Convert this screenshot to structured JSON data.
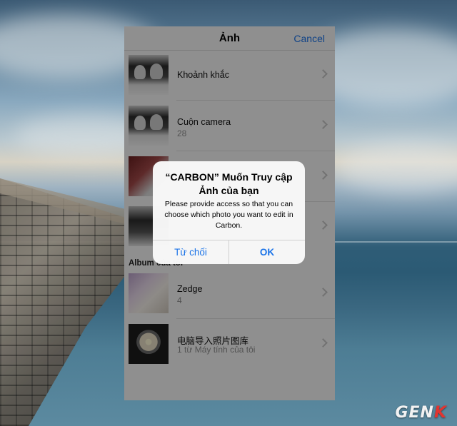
{
  "navbar": {
    "title": "Ảnh",
    "cancel_label": "Cancel"
  },
  "albums": [
    {
      "title": "Khoảnh khắc",
      "count": ""
    },
    {
      "title": "Cuộn camera",
      "count": "28"
    }
  ],
  "section_header": "Album của tôi",
  "my_albums": [
    {
      "title": "Zedge",
      "count": "4"
    },
    {
      "title": "电脑导入照片图库",
      "count": "1 từ Máy tính của tôi"
    }
  ],
  "alert": {
    "title": "“CARBON” Muốn Truy cập Ảnh của bạn",
    "message": "Please provide access so that you can choose which photo you want to edit in Carbon.",
    "deny_label": "Từ chối",
    "ok_label": "OK"
  },
  "watermark": {
    "text_main": "GEN",
    "text_accent": "K"
  },
  "colors": {
    "link_blue": "#1a73e8",
    "dim_overlay": "rgba(0,0,0,0.42)"
  }
}
